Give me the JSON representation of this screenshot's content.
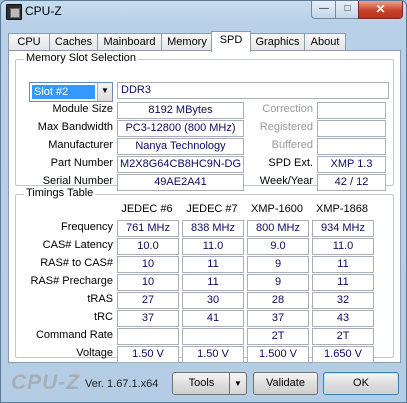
{
  "window": {
    "title": "CPU-Z",
    "minimize_glyph": "—",
    "maximize_glyph": "□",
    "close_glyph": "✕"
  },
  "tabs": [
    {
      "label": "CPU",
      "active": false
    },
    {
      "label": "Caches",
      "active": false
    },
    {
      "label": "Mainboard",
      "active": false
    },
    {
      "label": "Memory",
      "active": false
    },
    {
      "label": "SPD",
      "active": true
    },
    {
      "label": "Graphics",
      "active": false
    },
    {
      "label": "About",
      "active": false
    }
  ],
  "memory_slot": {
    "group_title": "Memory Slot Selection",
    "slot_value": "Slot #2",
    "type": "DDR3",
    "module_size_label": "Module Size",
    "module_size": "8192 MBytes",
    "max_bandwidth_label": "Max Bandwidth",
    "max_bandwidth": "PC3-12800 (800 MHz)",
    "manufacturer_label": "Manufacturer",
    "manufacturer": "Nanya Technology",
    "part_number_label": "Part Number",
    "part_number": "M2X8G64CB8HC9N-DG",
    "serial_number_label": "Serial Number",
    "serial_number": "49AE2A41",
    "correction_label": "Correction",
    "registered_label": "Registered",
    "buffered_label": "Buffered",
    "spd_ext_label": "SPD Ext.",
    "spd_ext": "XMP 1.3",
    "week_year_label": "Week/Year",
    "week_year": "42 / 12"
  },
  "timings": {
    "group_title": "Timings Table",
    "columns": [
      "JEDEC #6",
      "JEDEC #7",
      "XMP-1600",
      "XMP-1868"
    ],
    "rows": [
      {
        "label": "Frequency",
        "values": [
          "761 MHz",
          "838 MHz",
          "800 MHz",
          "934 MHz"
        ]
      },
      {
        "label": "CAS# Latency",
        "values": [
          "10.0",
          "11.0",
          "9.0",
          "11.0"
        ]
      },
      {
        "label": "RAS# to CAS#",
        "values": [
          "10",
          "11",
          "9",
          "11"
        ]
      },
      {
        "label": "RAS# Precharge",
        "values": [
          "10",
          "11",
          "9",
          "11"
        ]
      },
      {
        "label": "tRAS",
        "values": [
          "27",
          "30",
          "28",
          "32"
        ]
      },
      {
        "label": "tRC",
        "values": [
          "37",
          "41",
          "37",
          "43"
        ]
      },
      {
        "label": "Command Rate",
        "values": [
          "",
          "",
          "2T",
          "2T"
        ]
      },
      {
        "label": "Voltage",
        "values": [
          "1.50 V",
          "1.50 V",
          "1.500 V",
          "1.650 V"
        ]
      }
    ]
  },
  "footer": {
    "logo": "CPU-Z",
    "version": "Ver. 1.67.1.x64",
    "tools_label": "Tools",
    "validate_label": "Validate",
    "ok_label": "OK"
  },
  "colors": {
    "value_text": "#0c0c60",
    "selection": "#3399ff",
    "close_button": "#c7432a"
  },
  "icons": {
    "app": "cpu-z-app-icon",
    "dropdown": "chevron-down-icon"
  }
}
